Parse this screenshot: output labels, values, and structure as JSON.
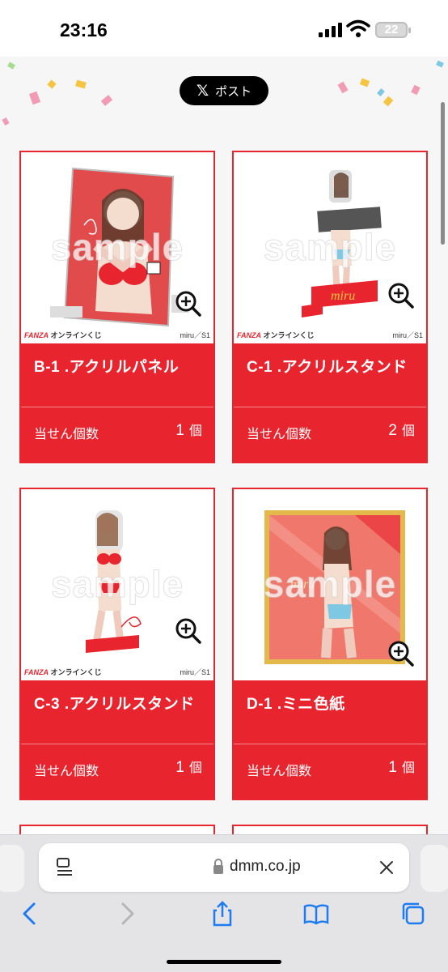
{
  "status_bar": {
    "time": "23:16",
    "battery": "22"
  },
  "post_button": {
    "label": "ポスト"
  },
  "cards": [
    {
      "title": "B-1 .アクリルパネル",
      "qty_label": "当せん個数",
      "qty": "1",
      "unit": "個",
      "watermark": "sample",
      "brand_a": "FANZA",
      "brand_b": "オンラインくじ",
      "credit": "miru／S1"
    },
    {
      "title": "C-1 .アクリルスタンド",
      "qty_label": "当せん個数",
      "qty": "2",
      "unit": "個",
      "watermark": "sample",
      "brand_a": "FANZA",
      "brand_b": "オンラインくじ",
      "credit": "miru／S1"
    },
    {
      "title": "C-3 .アクリルスタンド",
      "qty_label": "当せん個数",
      "qty": "1",
      "unit": "個",
      "watermark": "sample",
      "brand_a": "FANZA",
      "brand_b": "オンラインくじ",
      "credit": "miru／S1"
    },
    {
      "title": "D-1 .ミニ色紙",
      "qty_label": "当せん個数",
      "qty": "1",
      "unit": "個",
      "watermark": "sample"
    }
  ],
  "browser": {
    "url": "dmm.co.jp"
  },
  "colors": {
    "accent": "#e8242e",
    "confetti": [
      "#f29bb5",
      "#f5c542",
      "#7ec8e3",
      "#a7dc8e"
    ]
  }
}
